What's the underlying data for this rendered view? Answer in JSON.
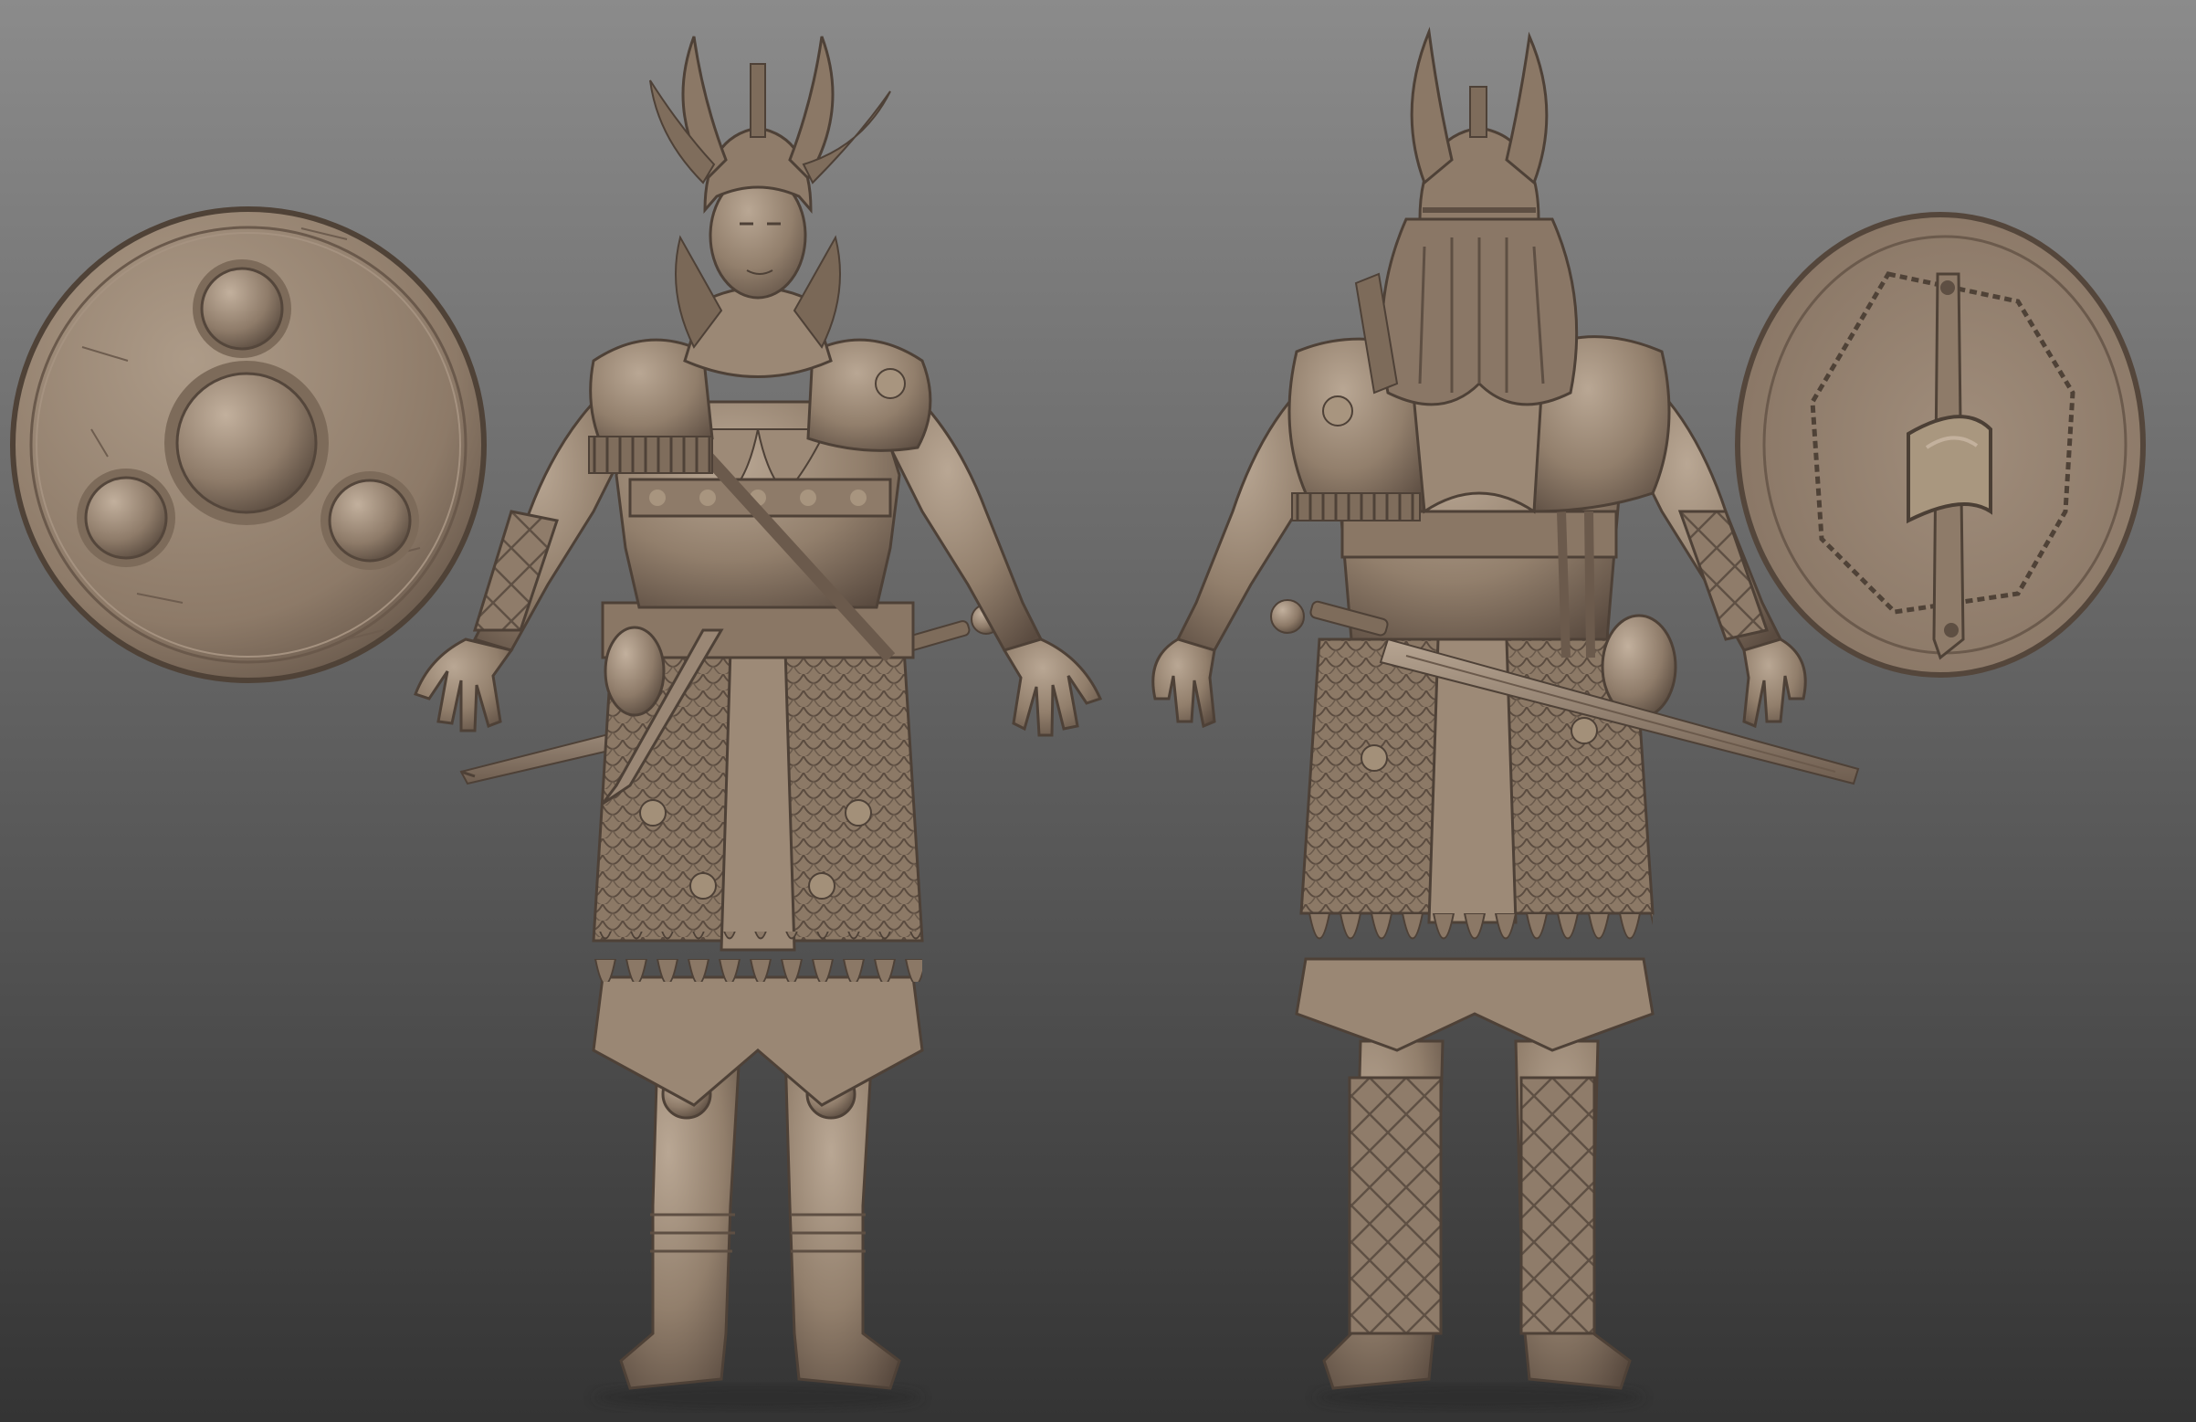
{
  "scene": {
    "colors": {
      "background_top": "#8b8b8b",
      "background_bottom": "#353535",
      "clay_light": "#b3a18f",
      "clay_mid": "#8d7a68",
      "clay_dark": "#5e4f43",
      "clay_shadow": "#3d332c"
    },
    "objects": [
      "shield-front",
      "warrior-front",
      "warrior-back",
      "shield-back"
    ]
  }
}
